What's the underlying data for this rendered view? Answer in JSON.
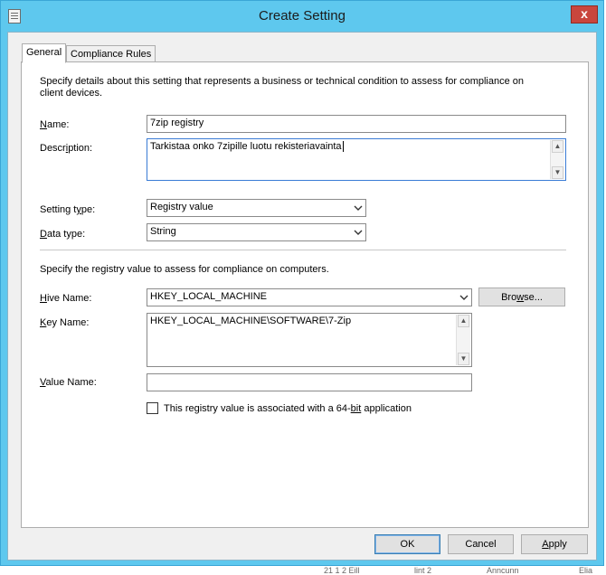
{
  "window": {
    "title": "Create Setting",
    "close_glyph": "x"
  },
  "tabs": [
    {
      "label": "General",
      "active": true
    },
    {
      "label": "Compliance Rules",
      "active": false
    }
  ],
  "general": {
    "intro": "Specify details about this setting that represents a business or technical condition to assess for compliance on client devices.",
    "name_label_u": "N",
    "name_label_rest": "ame:",
    "name_value": "7zip registry",
    "description_label_pre": "Descr",
    "description_label_u": "i",
    "description_label_rest": "ption:",
    "description_value": "Tarkistaa onko 7zipille luotu rekisteriavainta",
    "setting_type_label_pre": "Setting t",
    "setting_type_label_u": "y",
    "setting_type_label_rest": "pe:",
    "setting_type_value": "Registry value",
    "data_type_label_u": "D",
    "data_type_label_rest": "ata type:",
    "data_type_value": "String",
    "registry_intro": "Specify the registry value to assess for compliance on computers.",
    "hive_label_u": "H",
    "hive_label_rest": "ive Name:",
    "hive_value": "HKEY_LOCAL_MACHINE",
    "browse_label_pre": "Bro",
    "browse_label_u": "w",
    "browse_label_rest": "se...",
    "key_label_u": "K",
    "key_label_rest": "ey Name:",
    "key_value": "HKEY_LOCAL_MACHINE\\SOFTWARE\\7-Zip",
    "value_name_label_u": "V",
    "value_name_label_rest": "alue Name:",
    "value_name_value": "",
    "checkbox_label_pre": "This registry value is associated with a 64-",
    "checkbox_label_u": "bit",
    "checkbox_label_rest": " application",
    "checkbox_checked": false
  },
  "footer": {
    "ok_label": "OK",
    "cancel_label": "Cancel",
    "apply_label_u": "A",
    "apply_label_rest": "pply"
  },
  "background": {
    "fragments": [
      "21 1 2 Eill",
      "lint 2",
      "Anncunn",
      "Elia"
    ]
  },
  "colors": {
    "title_bar": "#5ec8ee",
    "close_button": "#c9463d",
    "dialog_bg": "#f0f0f0",
    "default_button_border": "#3c7fb1"
  },
  "icons": {
    "window_icon": "document-icon",
    "combo_arrow": "chevron-down-icon",
    "scroll_up": "scroll-up-arrow-icon",
    "scroll_down": "scroll-down-arrow-icon"
  }
}
